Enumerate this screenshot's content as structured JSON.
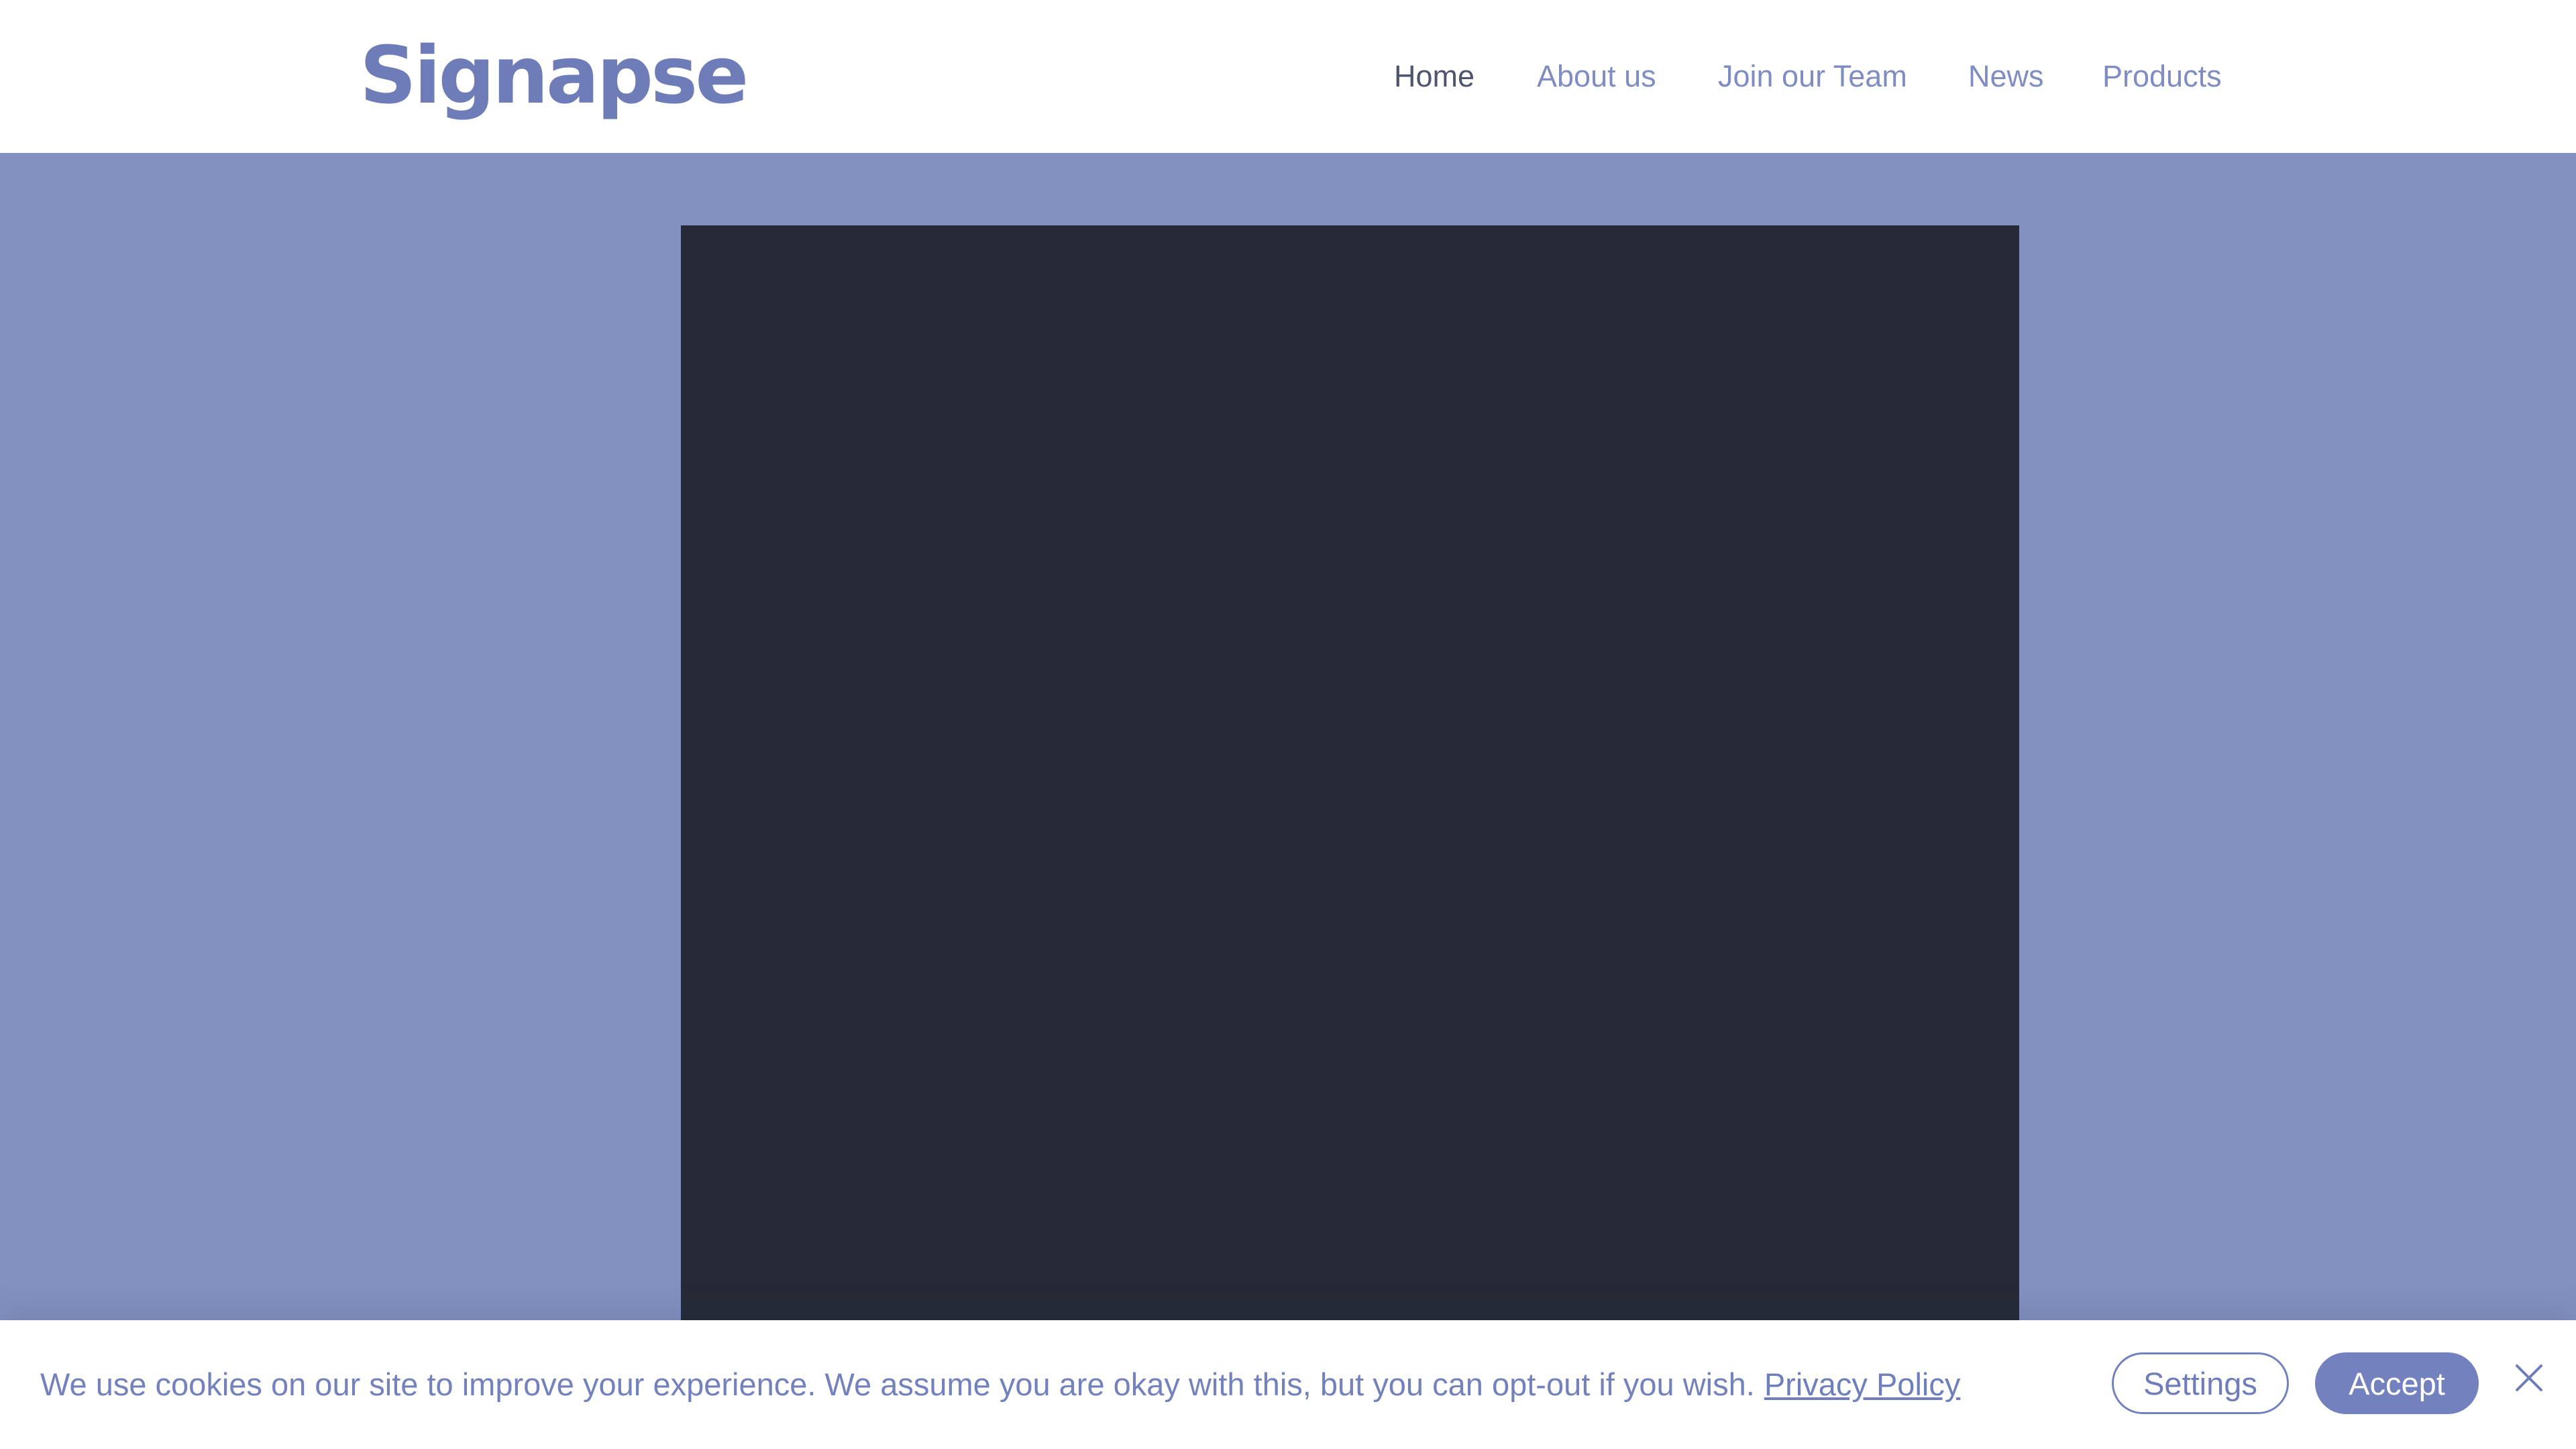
{
  "header": {
    "logo_text": "Signapse",
    "nav": [
      {
        "label": "Home",
        "active": true
      },
      {
        "label": "About us"
      },
      {
        "label": "Join our Team"
      },
      {
        "label": "News"
      },
      {
        "label": "Products"
      }
    ]
  },
  "main": {
    "video_icon": "video-player-frame"
  },
  "cookie_banner": {
    "message": "We use cookies on our site to improve your experience. We assume you are okay with this, but you can opt-out if you wish.",
    "privacy_link": "Privacy Policy",
    "settings_label": "Settings",
    "accept_label": "Accept",
    "close_icon": "close-icon"
  },
  "colors": {
    "brand": "#7382be",
    "background": "#8391c0",
    "video_frame": "#262a36",
    "nav_active": "#4f5570"
  }
}
